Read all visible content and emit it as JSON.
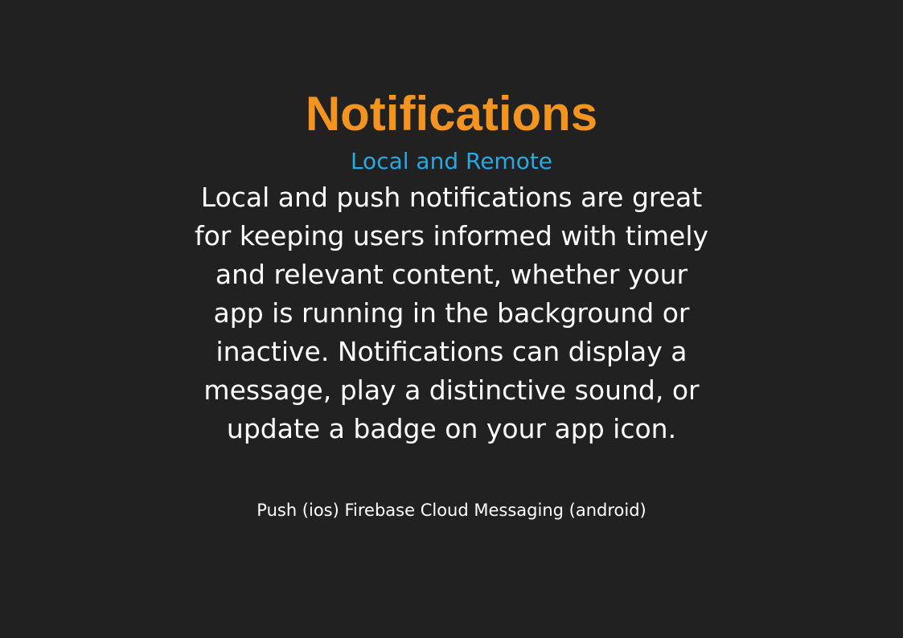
{
  "slide": {
    "title": "Notifications",
    "subtitle": "Local and Remote",
    "body_lines": [
      "Local and push notifications are great",
      "for keeping users informed with timely",
      "and relevant content, whether your",
      "app is running in the background or",
      "inactive. Notifications can display a",
      "message, play a distinctive sound, or",
      "update a badge on your app icon."
    ],
    "footnote": "Push (ios) Firebase Cloud Messaging (android)"
  },
  "colors": {
    "background": "#212121",
    "title": "#f39320",
    "subtitle": "#2aa8e0",
    "text": "#ffffff"
  }
}
